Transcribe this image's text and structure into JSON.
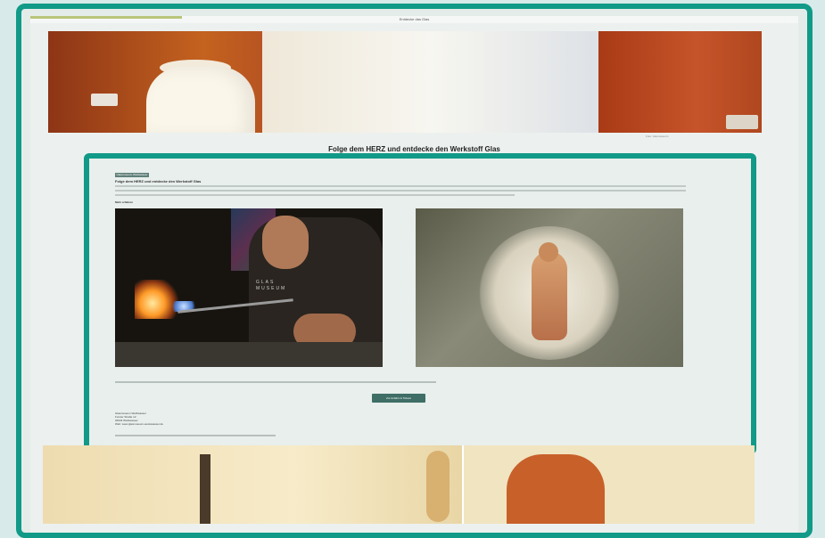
{
  "browser": {
    "top_label": "Entdecke das Glas"
  },
  "hero": {
    "credit": "Foto: Glasmuseum"
  },
  "main": {
    "heading": "Folge dem HERZ und entdecke den Werkstoff Glas"
  },
  "article": {
    "tag": "Glasmuseum Weißwasser",
    "title": "Folge dem HERZ und entdecke den Werkstoff Glas",
    "more_link": "Mehr erfahren",
    "photo1_shirt_text": "GLAS\nMUSEUM",
    "cta_label": "Zur Anfahrt & Tickets",
    "address_lines": [
      "Glasmuseum Weißwasser",
      "Forster Straße 12",
      "02943 Weißwasser",
      "Web: www.glasmuseum-weisswasser.de"
    ]
  },
  "colors": {
    "highlight_border": "#119a88",
    "cta_bg": "#3f6e66",
    "page_bg": "#d8ebea"
  }
}
